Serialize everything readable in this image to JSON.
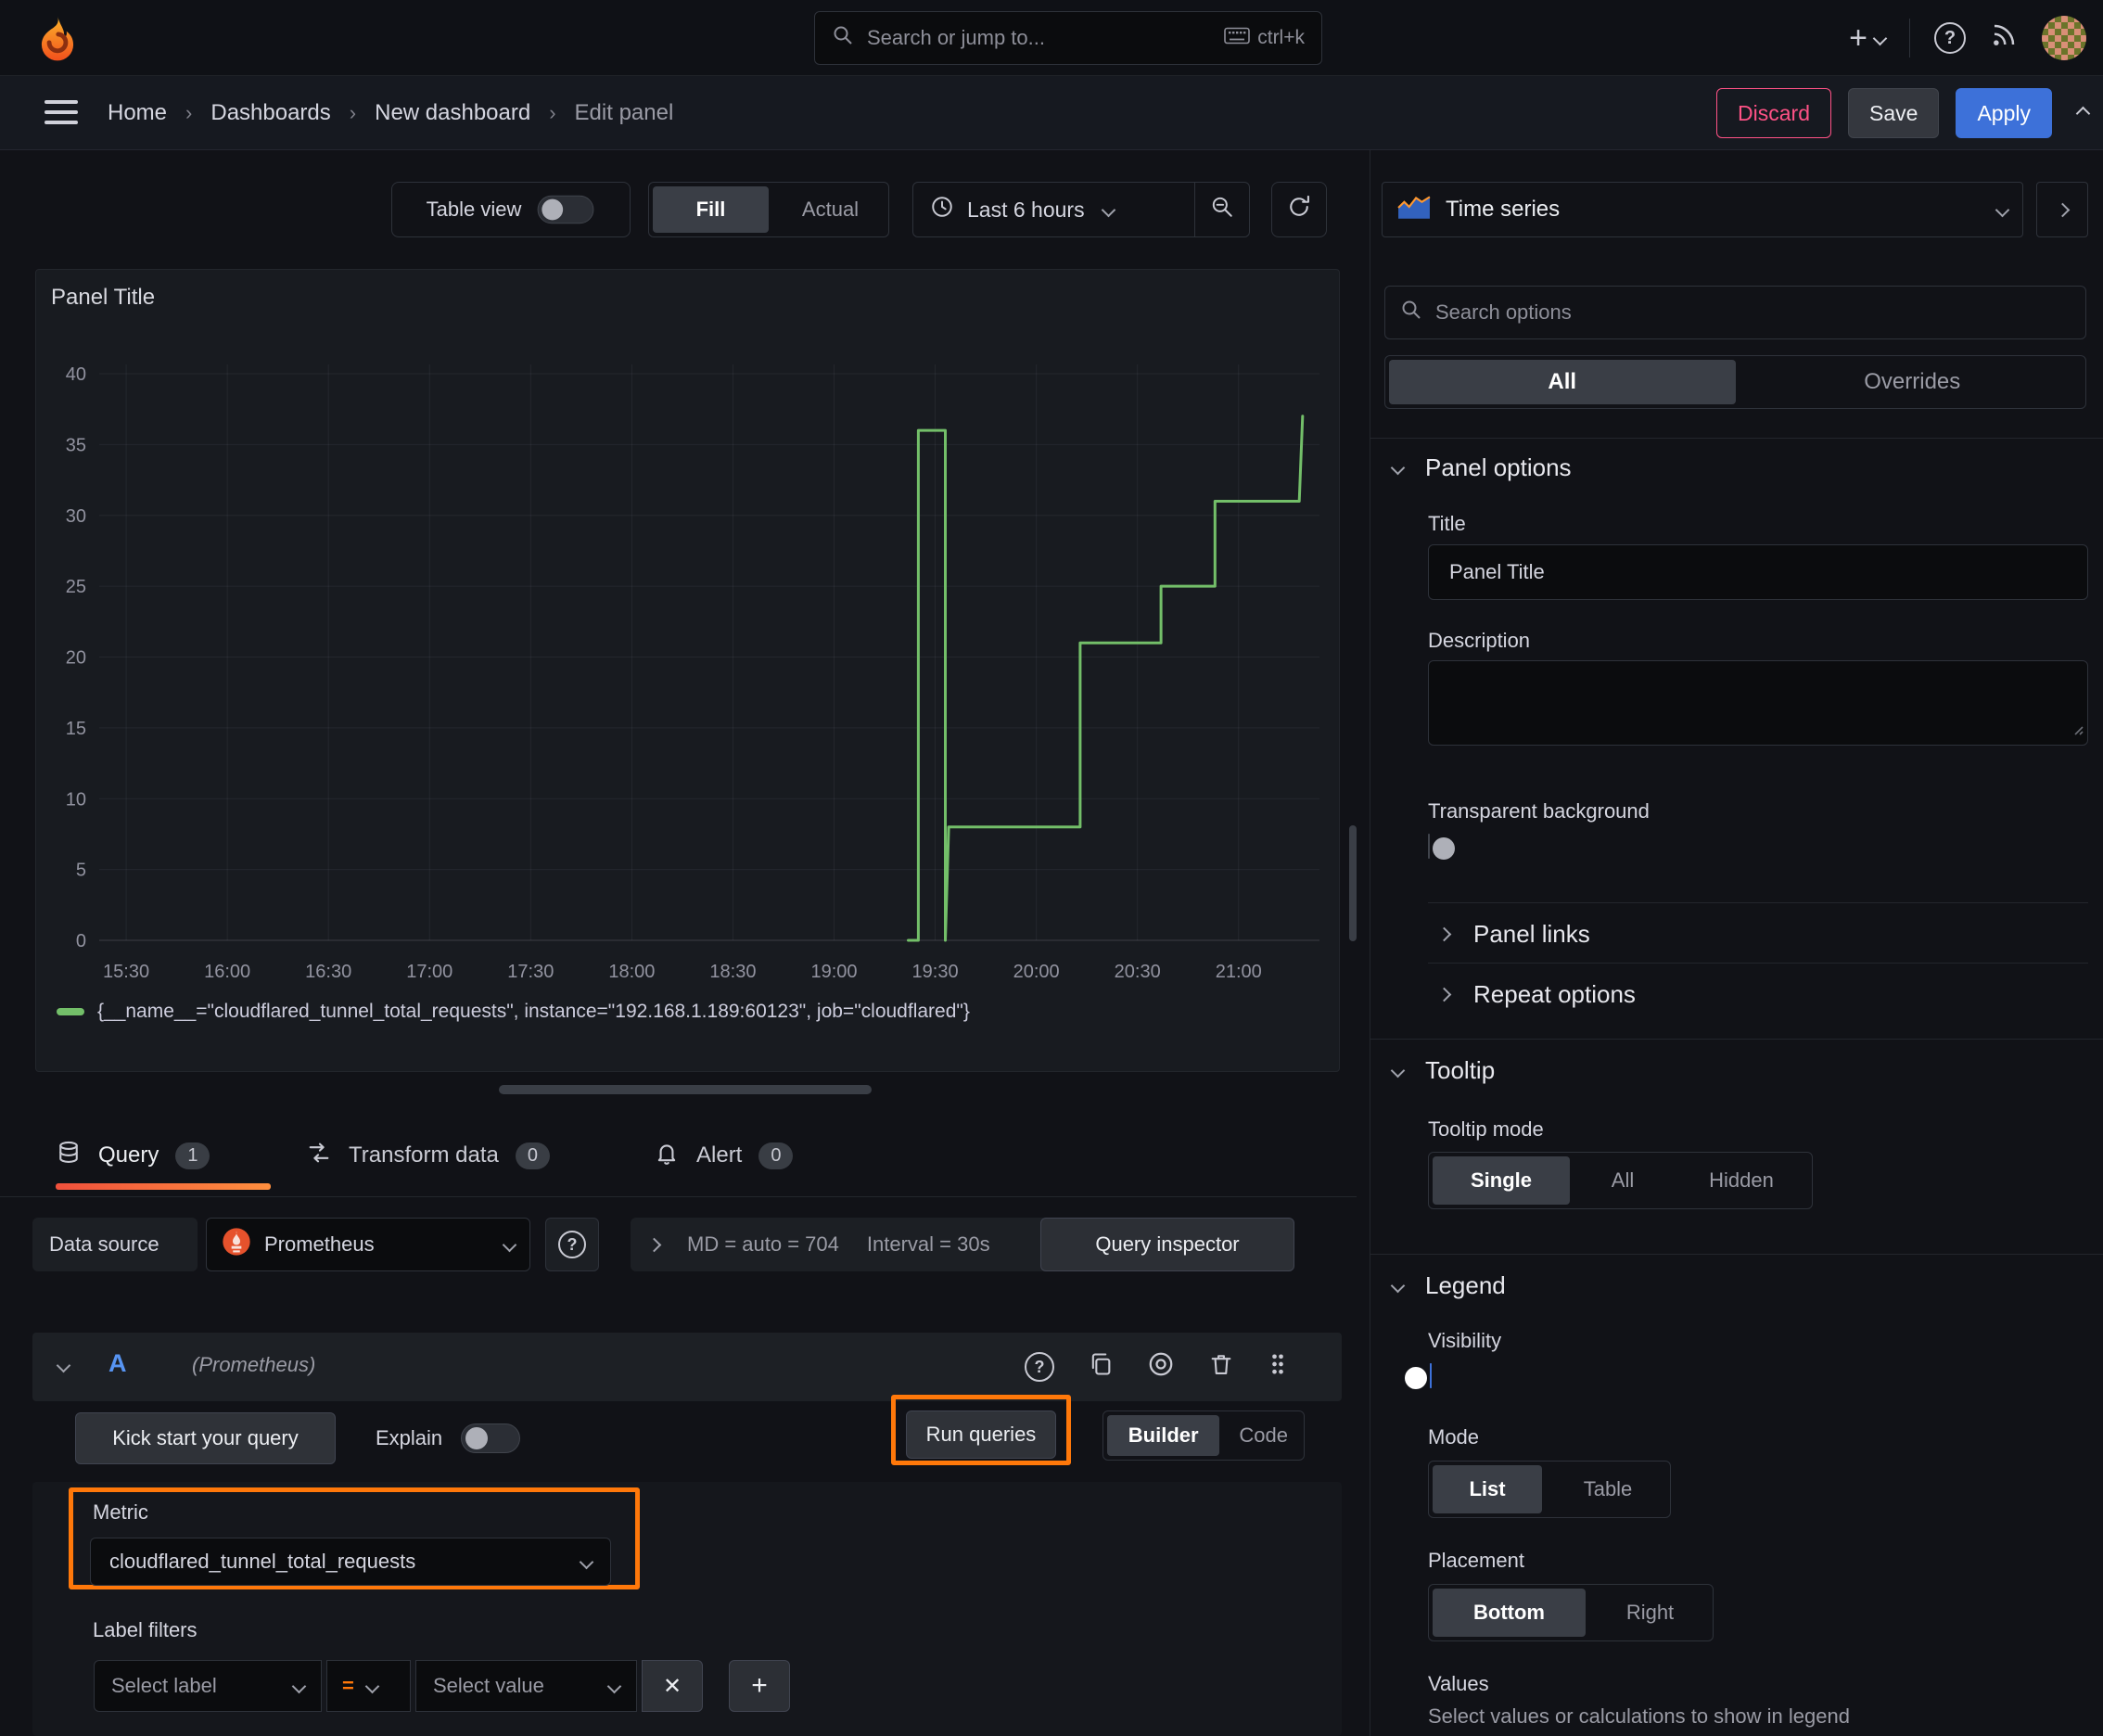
{
  "colors": {
    "accent_orange": "#ff780a",
    "series_green": "#73bf69",
    "primary_blue": "#3d71d9",
    "danger_pink": "#ff5286",
    "prometheus_orange": "#e6522c"
  },
  "topbar": {
    "search_placeholder": "Search or jump to...",
    "search_shortcut": "ctrl+k"
  },
  "breadcrumbs": {
    "items": [
      {
        "label": "Home"
      },
      {
        "label": "Dashboards"
      },
      {
        "label": "New dashboard"
      },
      {
        "label": "Edit panel"
      }
    ],
    "discard_label": "Discard",
    "save_label": "Save",
    "apply_label": "Apply"
  },
  "view_toolbar": {
    "table_view_label": "Table view",
    "fill_label": "Fill",
    "actual_label": "Actual",
    "time_range_label": "Last 6 hours"
  },
  "panel": {
    "title": "Panel Title"
  },
  "chart_data": {
    "type": "line",
    "title": "Panel Title",
    "x_ticks": [
      "15:30",
      "16:00",
      "16:30",
      "17:00",
      "17:30",
      "18:00",
      "18:30",
      "19:00",
      "19:30",
      "20:00",
      "20:30",
      "21:00"
    ],
    "x_range": [
      "15:22",
      "21:24"
    ],
    "y_ticks": [
      0,
      5,
      10,
      15,
      20,
      25,
      30,
      35,
      40
    ],
    "ylim": [
      0,
      40
    ],
    "grid": true,
    "legend_position": "bottom",
    "series": [
      {
        "name": "{__name__=\"cloudflared_tunnel_total_requests\", instance=\"192.168.1.189:60123\", job=\"cloudflared\"}",
        "color": "#73bf69",
        "points": [
          [
            "19:22",
            0
          ],
          [
            "19:25",
            0
          ],
          [
            "19:25",
            36
          ],
          [
            "19:33",
            36
          ],
          [
            "19:33",
            0
          ],
          [
            "19:34",
            8
          ],
          [
            "20:13",
            8
          ],
          [
            "20:13",
            21
          ],
          [
            "20:37",
            21
          ],
          [
            "20:37",
            25
          ],
          [
            "20:53",
            25
          ],
          [
            "20:53",
            31
          ],
          [
            "21:18",
            31
          ],
          [
            "21:19",
            37
          ]
        ]
      }
    ]
  },
  "query_section": {
    "tabs": [
      {
        "label": "Query",
        "count": "1"
      },
      {
        "label": "Transform data",
        "count": "0"
      },
      {
        "label": "Alert",
        "count": "0"
      }
    ],
    "datasource": {
      "label": "Data source",
      "value": "Prometheus",
      "stats_md": "MD = auto = 704",
      "stats_interval": "Interval = 30s",
      "inspector_label": "Query inspector"
    },
    "query_row": {
      "ref_id": "A",
      "datasource_hint": "(Prometheus)"
    },
    "editor_toolbar": {
      "kick_start_label": "Kick start your query",
      "explain_label": "Explain",
      "run_queries_label": "Run queries",
      "builder_label": "Builder",
      "code_label": "Code"
    },
    "builder": {
      "metric_label": "Metric",
      "metric_value": "cloudflared_tunnel_total_requests",
      "label_filters_label": "Label filters",
      "select_label_placeholder": "Select label",
      "operator": "=",
      "select_value_placeholder": "Select value"
    }
  },
  "sidebar": {
    "visualization": "Time series",
    "search_placeholder": "Search options",
    "filter_tabs": {
      "all": "All",
      "overrides": "Overrides"
    },
    "panel_options": {
      "header": "Panel options",
      "title_label": "Title",
      "title_value": "Panel Title",
      "description_label": "Description",
      "transparent_label": "Transparent background"
    },
    "collapsed": {
      "panel_links": "Panel links",
      "repeat_options": "Repeat options"
    },
    "tooltip": {
      "header": "Tooltip",
      "mode_label": "Tooltip mode",
      "options": [
        {
          "label": "Single"
        },
        {
          "label": "All"
        },
        {
          "label": "Hidden"
        }
      ]
    },
    "legend": {
      "header": "Legend",
      "visibility_label": "Visibility",
      "mode_label": "Mode",
      "mode_options": [
        {
          "label": "List"
        },
        {
          "label": "Table"
        }
      ],
      "placement_label": "Placement",
      "placement_options": [
        {
          "label": "Bottom"
        },
        {
          "label": "Right"
        }
      ],
      "values_label": "Values",
      "values_hint": "Select values or calculations to show in legend"
    }
  }
}
